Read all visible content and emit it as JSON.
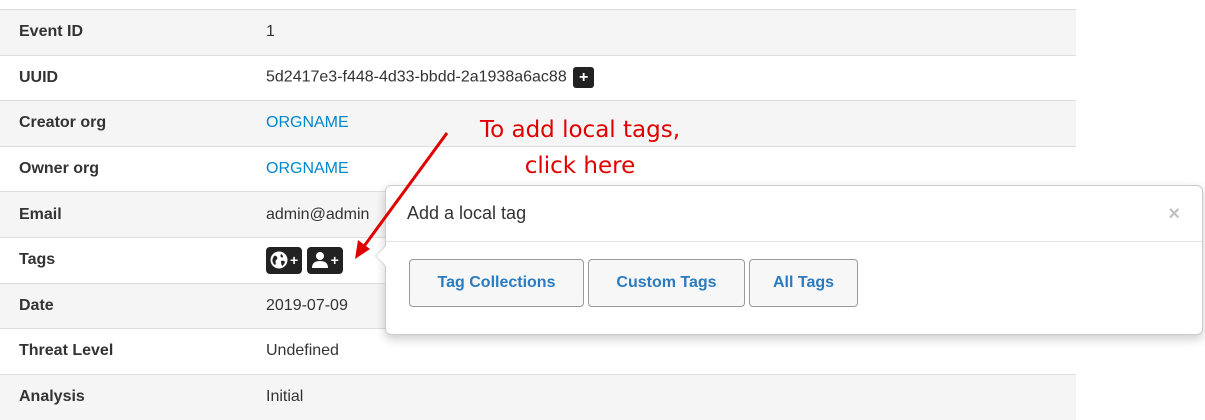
{
  "event_info": {
    "rows": [
      {
        "key": "Event ID",
        "value": "1"
      },
      {
        "key": "UUID",
        "value": "5d2417e3-f448-4d33-bbdd-2a1938a6ac88",
        "copy_button": "+"
      },
      {
        "key": "Creator org",
        "value": "ORGNAME"
      },
      {
        "key": "Owner org",
        "value": "ORGNAME"
      },
      {
        "key": "Email",
        "value": "admin@admin"
      },
      {
        "key": "Tags",
        "value": ""
      },
      {
        "key": "Date",
        "value": "2019-07-09"
      },
      {
        "key": "Threat Level",
        "value": "Undefined"
      },
      {
        "key": "Analysis",
        "value": "Initial"
      }
    ],
    "tag_buttons": [
      {
        "icon": "globe-icon",
        "label": "+"
      },
      {
        "icon": "user-icon",
        "label": "+"
      }
    ]
  },
  "popover": {
    "title": "Add a local tag",
    "close_label": "×",
    "buttons": [
      "Tag Collections",
      "Custom Tags",
      "All Tags"
    ]
  },
  "annotation": {
    "line1": "To add local tags,",
    "line2": "click here",
    "color": "#e00000"
  },
  "colors": {
    "link": "#0088cc",
    "button_text": "#2a7bbf",
    "dark_button": "#222222",
    "row_stripe": "#f5f5f5"
  }
}
